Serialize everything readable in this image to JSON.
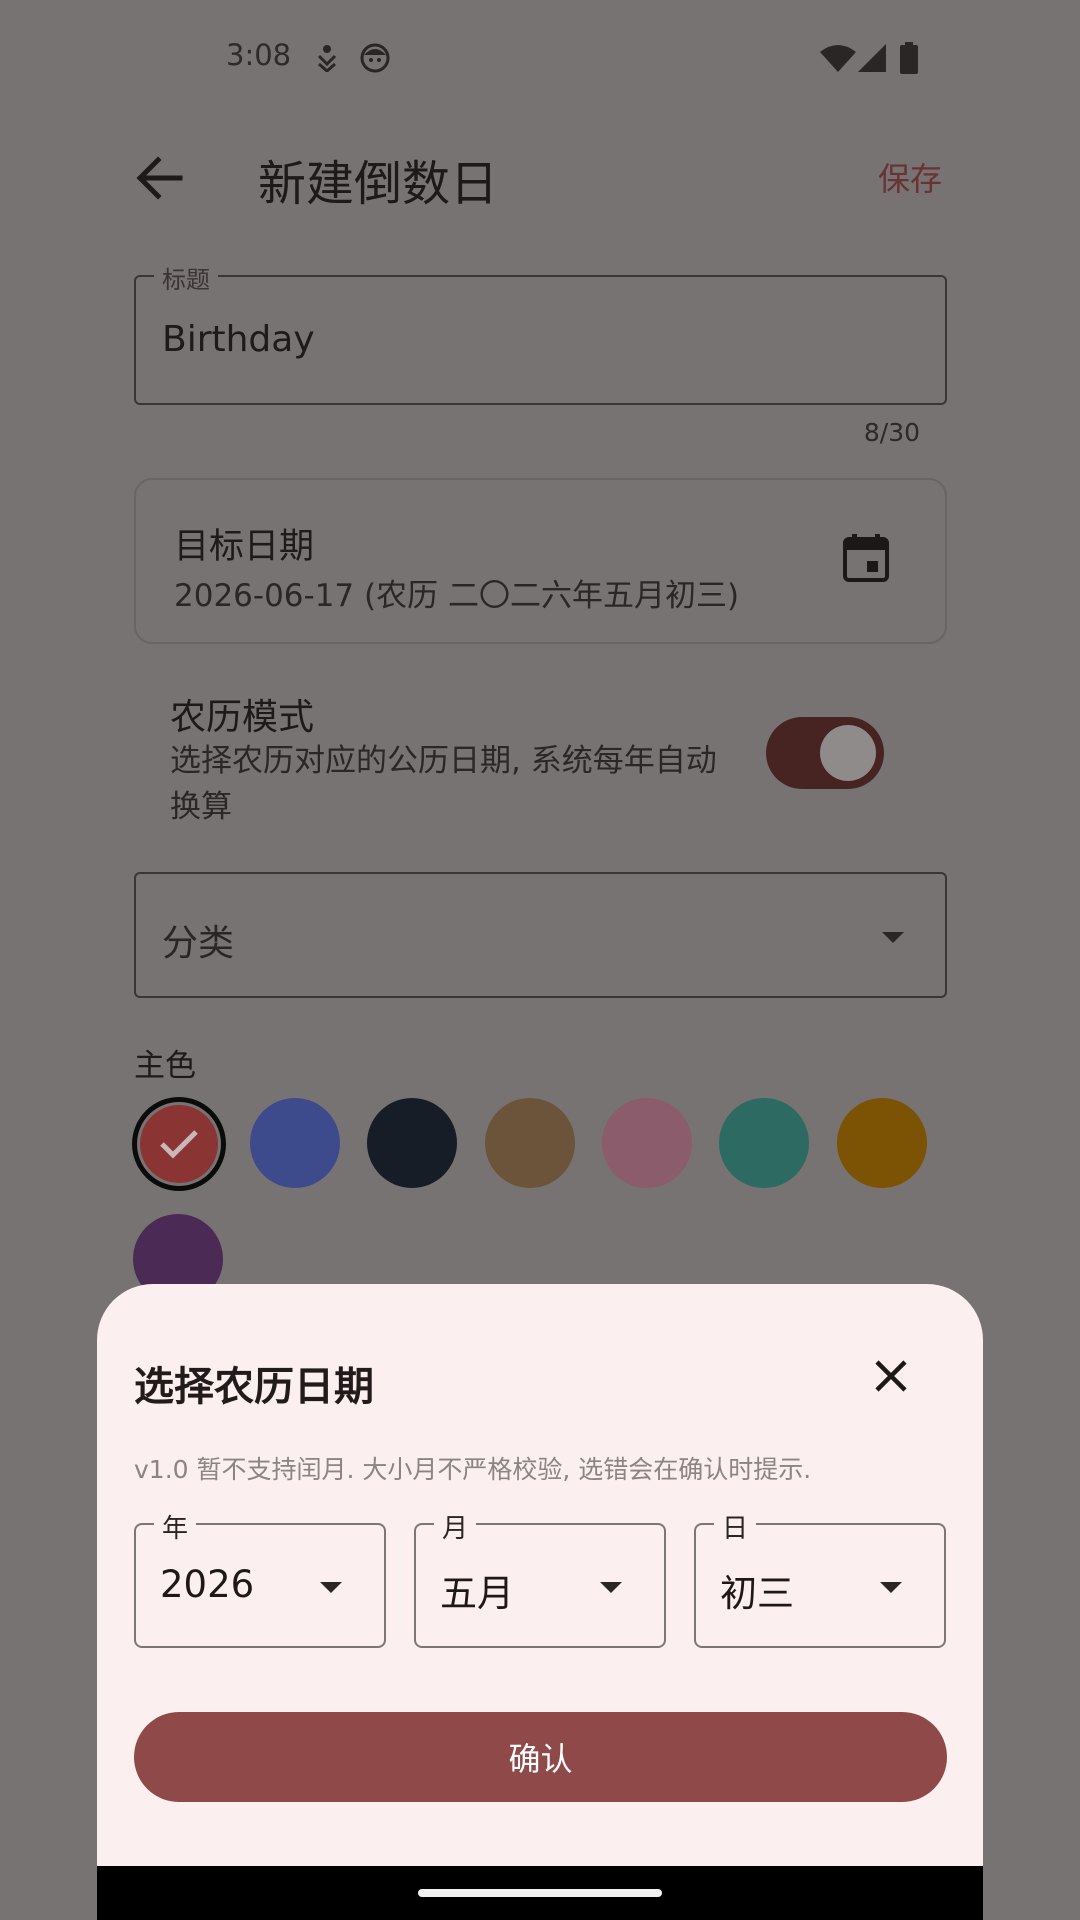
{
  "status_bar": {
    "time": "3:08",
    "icons": [
      "download-person-icon",
      "face-icon",
      "wifi-icon",
      "signal-icon",
      "battery-icon"
    ]
  },
  "app_bar": {
    "back_icon": "arrow-back-icon",
    "title": "新建倒数日",
    "save_label": "保存"
  },
  "form": {
    "title_field": {
      "label": "标题",
      "value": "Birthday",
      "counter": "8/30"
    },
    "target_date": {
      "label": "目标日期",
      "value": "2026-06-17 (农历 二〇二六年五月初三)",
      "icon": "calendar-icon"
    },
    "lunar_mode": {
      "title": "农历模式",
      "description": "选择农历对应的公历日期, 系统每年自动换算",
      "enabled": true
    },
    "category": {
      "label": "分类"
    },
    "primary_color": {
      "heading": "主色",
      "selected_index": 0,
      "swatches": [
        "#8b3434",
        "#3d4a8c",
        "#161d27",
        "#6b5439",
        "#8a5c6c",
        "#2c6a62",
        "#7c5204",
        "#4b2b55"
      ]
    }
  },
  "lunar_sheet": {
    "title": "选择农历日期",
    "close_icon": "close-icon",
    "hint": "v1.0 暂不支持闰月. 大小月不严格校验, 选错会在确认时提示.",
    "year": {
      "label": "年",
      "value": "2026"
    },
    "month": {
      "label": "月",
      "value": "五月"
    },
    "day": {
      "label": "日",
      "value": "初三"
    },
    "confirm_label": "确认"
  },
  "colors": {
    "scrim_background": "#777373",
    "sheet_background": "#fcefef",
    "accent": "#904949",
    "toggle_track": "#472322"
  }
}
